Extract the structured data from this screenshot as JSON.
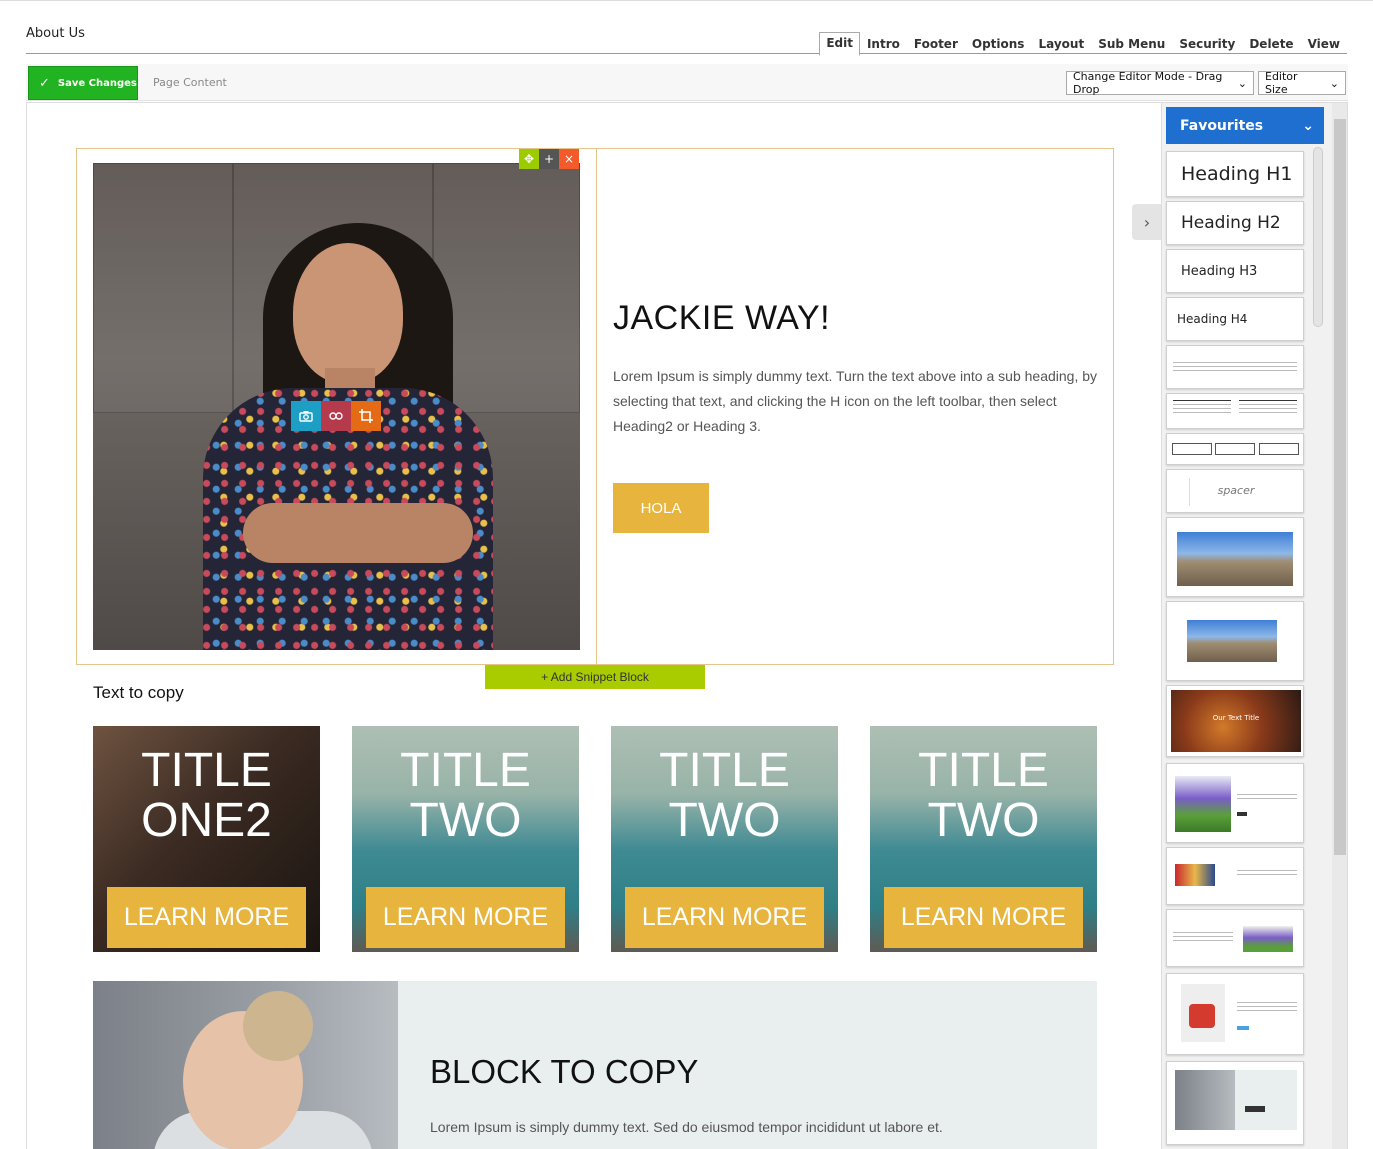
{
  "header": {
    "page_name": "About Us",
    "tabs": [
      {
        "label": "Edit",
        "active": true
      },
      {
        "label": "Intro"
      },
      {
        "label": "Footer"
      },
      {
        "label": "Options"
      },
      {
        "label": "Layout"
      },
      {
        "label": "Sub Menu"
      },
      {
        "label": "Security"
      },
      {
        "label": "Delete"
      },
      {
        "label": "View"
      }
    ]
  },
  "toolbar": {
    "save_label": "Save Changes",
    "section_label": "Page Content",
    "editor_mode": "Change Editor Mode - Drag Drop",
    "editor_size": "Editor Size"
  },
  "hero": {
    "title": "JACKIE WAY!",
    "text": "Lorem Ipsum is simply dummy text. Turn the text above into a sub heading, by selecting that text, and clicking the H icon on the left toolbar, then select Heading2 or Heading 3.",
    "button": "HOLA",
    "block_tools": {
      "move": "move-icon",
      "add": "+",
      "delete": "×"
    },
    "image_tools": [
      "camera-icon",
      "link-icon",
      "crop-icon"
    ]
  },
  "add_snippet": "+ Add Snippet Block",
  "section_label": "Text to copy",
  "cards": [
    {
      "title_line1": "TITLE",
      "title_line2": "ONE2",
      "button": "LEARN MORE",
      "style": "girl"
    },
    {
      "title_line1": "TITLE",
      "title_line2": "TWO",
      "button": "LEARN MORE",
      "style": "sea"
    },
    {
      "title_line1": "TITLE",
      "title_line2": "TWO",
      "button": "LEARN MORE",
      "style": "sea"
    },
    {
      "title_line1": "TITLE",
      "title_line2": "TWO",
      "button": "LEARN MORE",
      "style": "sea"
    }
  ],
  "block2": {
    "title": "BLOCK TO COPY",
    "text": "Lorem Ipsum is simply dummy text. Sed do eiusmod tempor incididunt ut labore et."
  },
  "sidebar": {
    "category": "Favourites",
    "headings": [
      "Heading H1",
      "Heading H2",
      "Heading H3",
      "Heading H4"
    ],
    "spacer_label": "spacer",
    "our_text_title": "Our Text Title"
  },
  "colors": {
    "save_green": "#21b321",
    "accent_gold": "#e7b53e",
    "snippet_green": "#a8cc00",
    "favourites_blue": "#1f6fd1"
  }
}
